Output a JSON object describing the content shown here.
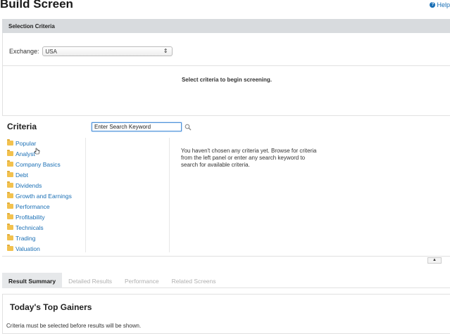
{
  "header": {
    "title": "Build Screen",
    "help_label": "Help"
  },
  "selection_criteria": {
    "header": "Selection Criteria",
    "exchange_label": "Exchange:",
    "exchange_value": "USA",
    "message": "Select criteria to begin screening."
  },
  "criteria": {
    "title": "Criteria",
    "search_placeholder": "Enter Search Keyword",
    "categories": [
      "Popular",
      "Analyst",
      "Company Basics",
      "Debt",
      "Dividends",
      "Growth and Earnings",
      "Performance",
      "Profitability",
      "Technicals",
      "Trading",
      "Valuation"
    ],
    "empty_message": "You haven't chosen any criteria yet. Browse for criteria from the left panel or enter any search keyword to search for available criteria."
  },
  "tabs": [
    "Result Summary",
    "Detailed Results",
    "Performance",
    "Related Screens"
  ],
  "results": {
    "title": "Today's Top Gainers",
    "message": "Criteria must be selected before results will be shown."
  },
  "colors": {
    "link": "#1a6fb5",
    "header_bg": "#d8dbde",
    "folder": "#f2c14e"
  }
}
